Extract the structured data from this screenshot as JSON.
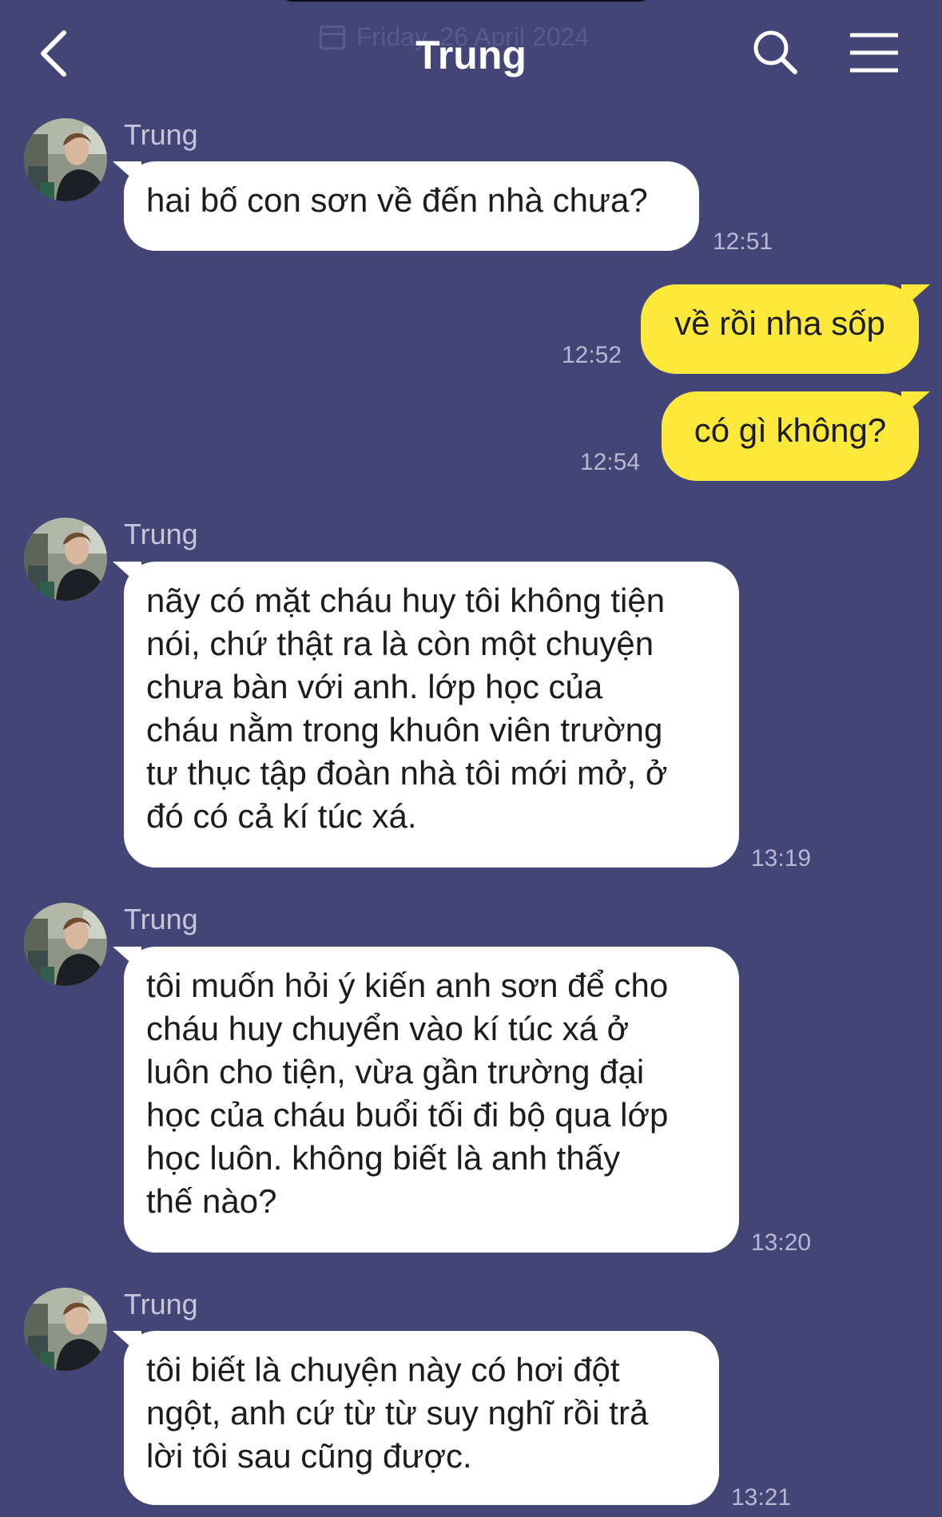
{
  "header": {
    "title": "Trung",
    "date_ghost": "Friday, 26 April 2024",
    "icons": {
      "back": "chevron-left-icon",
      "search": "search-icon",
      "menu": "hamburger-menu-icon"
    }
  },
  "colors": {
    "background": "#434576",
    "incoming_bubble": "#ffffff",
    "outgoing_bubble": "#fde93b",
    "text": "#1c1c1c"
  },
  "messages": [
    {
      "sender": "Trung",
      "direction": "incoming",
      "text": "hai bố con sơn về đến nhà chưa?",
      "time": "12:51"
    },
    {
      "direction": "outgoing",
      "text": "về rồi nha sốp",
      "time": "12:52"
    },
    {
      "direction": "outgoing",
      "text": "có gì không?",
      "time": "12:54"
    },
    {
      "sender": "Trung",
      "direction": "incoming",
      "text": "nãy có mặt cháu huy tôi không tiện\nnói, chứ thật ra là còn một chuyện\nchưa bàn với anh. lớp học của\ncháu nằm trong khuôn viên trường\ntư thục tập đoàn nhà tôi mới mở, ở\nđó có cả kí túc xá.",
      "time": "13:19"
    },
    {
      "sender": "Trung",
      "direction": "incoming",
      "text": "tôi muốn hỏi ý kiến anh sơn để cho\ncháu huy chuyển vào kí túc xá ở\nluôn cho tiện, vừa gần trường đại\nhọc của cháu buổi tối đi bộ qua lớp\nhọc luôn. không biết là anh thấy\nthế nào?",
      "time": "13:20"
    },
    {
      "sender": "Trung",
      "direction": "incoming",
      "text": "tôi biết là chuyện này có hơi đột\nngột, anh cứ từ từ suy nghĩ rồi trả\nlời tôi sau cũng được.",
      "time": "13:21"
    }
  ]
}
